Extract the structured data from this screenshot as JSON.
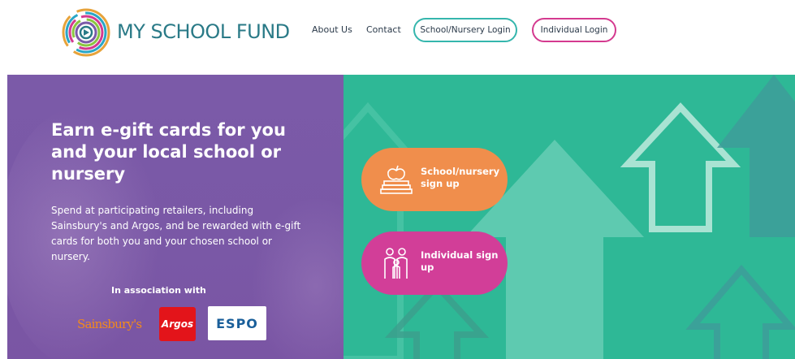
{
  "header": {
    "logo_text": "MY SCHOOL FUND",
    "nav": {
      "about": "About Us",
      "contact": "Contact"
    },
    "buttons": {
      "school_login": "School/Nursery Login",
      "individual_login": "Individual Login"
    }
  },
  "hero": {
    "title": "Earn e-gift cards for you and your local school or nursery",
    "body": "Spend at participating retailers, including Sainsbury's and Argos, and be rewarded with e-gift cards for both you and your chosen school or nursery.",
    "association_label": "In association with",
    "partners": {
      "sainsburys": "Sainsbury's",
      "argos": "Argos",
      "espo": "ESPO"
    }
  },
  "signup": {
    "school": "School/nursery sign up",
    "individual": "Individual sign up"
  },
  "colors": {
    "teal": "#2eb896",
    "purple": "#7b5aa8",
    "orange": "#f08e4c",
    "pink": "#d23e98",
    "logo_text": "#2a7a87"
  },
  "icons": {
    "logo": "circular-rings-logo",
    "school": "apple-on-books-icon",
    "individual": "family-icon"
  }
}
